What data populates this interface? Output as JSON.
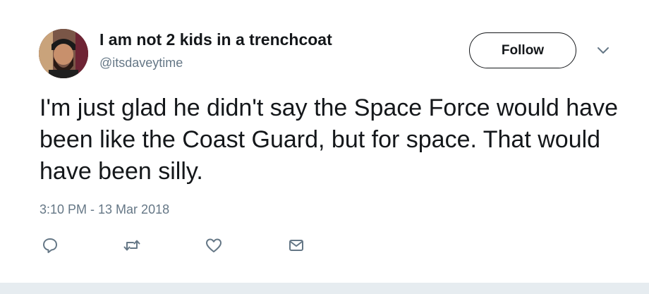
{
  "tweet": {
    "display_name": "I am not 2 kids in a trenchcoat",
    "handle": "@itsdaveytime",
    "follow_label": "Follow",
    "text": "I'm just glad he didn't say the Space Force would have been like the Coast Guard, but for space. That would have been silly.",
    "timestamp": "3:10 PM - 13 Mar 2018"
  },
  "actions": [
    {
      "name": "reply-icon"
    },
    {
      "name": "retweet-icon"
    },
    {
      "name": "like-icon"
    },
    {
      "name": "direct-message-icon"
    }
  ],
  "colors": {
    "text": "#14171a",
    "secondary_text": "#657786",
    "icon": "#657786",
    "background": "#ffffff",
    "footer_strip": "#e6ecf0"
  }
}
